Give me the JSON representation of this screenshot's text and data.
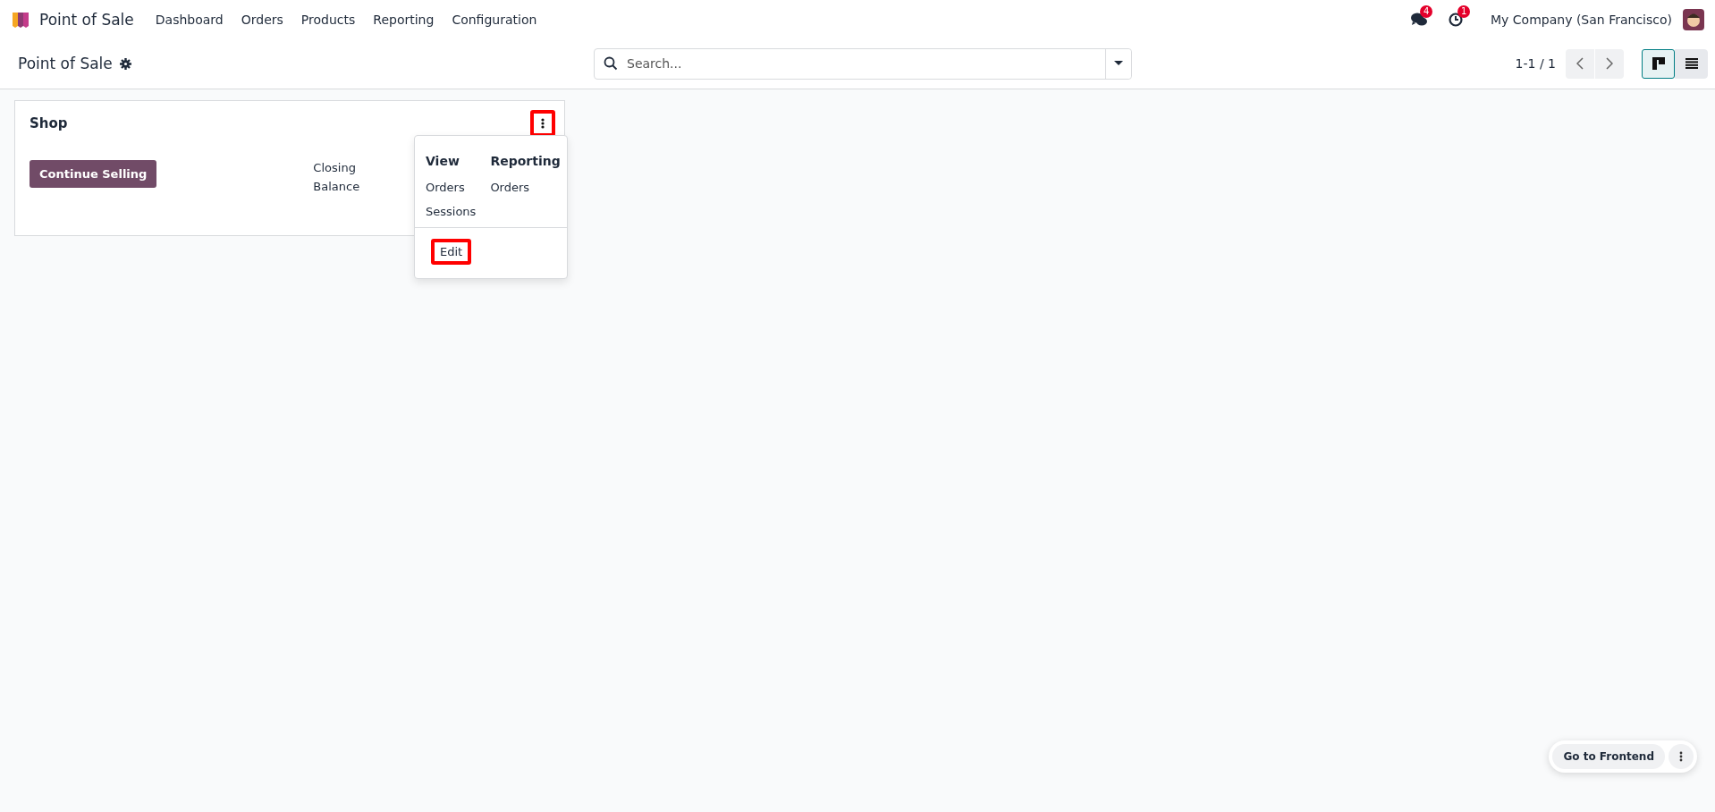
{
  "navbar": {
    "app_name": "Point of Sale",
    "menu": [
      "Dashboard",
      "Orders",
      "Products",
      "Reporting",
      "Configuration"
    ],
    "messages_badge": "4",
    "activities_badge": "1",
    "company": "My Company (San Francisco)"
  },
  "control_panel": {
    "title": "Point of Sale",
    "search": {
      "placeholder": "Search..."
    },
    "pager": "1-1 / 1",
    "views": [
      {
        "kind": "kanban",
        "selected": true
      },
      {
        "kind": "list",
        "selected": false
      }
    ]
  },
  "cards": [
    {
      "name": "Shop",
      "button": "Continue Selling",
      "label": "Closing Balance",
      "menu_button": {
        "highlighted": true
      },
      "dropdown": {
        "sections": [
          {
            "title": "View",
            "items": [
              "Orders",
              "Sessions"
            ]
          },
          {
            "title": "Reporting",
            "items": [
              "Orders"
            ]
          }
        ],
        "actions": [
          {
            "label": "Edit",
            "highlighted": true
          }
        ]
      }
    }
  ],
  "floating": {
    "button": "Go to Frontend"
  }
}
